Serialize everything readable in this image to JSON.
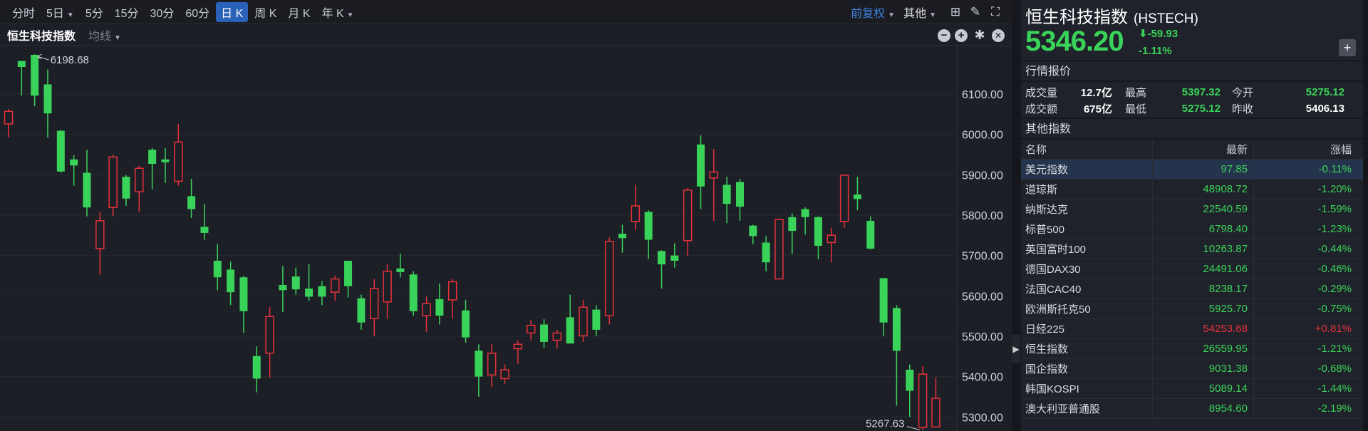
{
  "toolbar": {
    "periods": [
      "分时",
      "5日",
      "5分",
      "15分",
      "30分",
      "60分",
      "日 K",
      "周 K",
      "月 K",
      "年 K"
    ],
    "active": "日 K",
    "adjust": "前复权",
    "other": "其他"
  },
  "subbar": {
    "title": "恒生科技指数",
    "ma": "均线"
  },
  "header": {
    "name": "恒生科技指数",
    "code": "(HSTECH)",
    "price": "5346.20",
    "change": "-59.93",
    "change_pct": "-1.11%"
  },
  "quote": {
    "section": "行情报价",
    "volume_label": "成交量",
    "volume": "12.7亿",
    "high_label": "最高",
    "high": "5397.32",
    "open_label": "今开",
    "open": "5275.12",
    "amount_label": "成交额",
    "amount": "675亿",
    "low_label": "最低",
    "low": "5275.12",
    "prev_label": "昨收",
    "prev": "5406.13"
  },
  "others": {
    "section": "其他指数",
    "headers": [
      "名称",
      "最新",
      "涨幅"
    ],
    "rows": [
      {
        "name": "美元指数",
        "last": "97.85",
        "chg": "-0.11%",
        "dir": "down"
      },
      {
        "name": "道琼斯",
        "last": "48908.72",
        "chg": "-1.20%",
        "dir": "down"
      },
      {
        "name": "纳斯达克",
        "last": "22540.59",
        "chg": "-1.59%",
        "dir": "down"
      },
      {
        "name": "标普500",
        "last": "6798.40",
        "chg": "-1.23%",
        "dir": "down"
      },
      {
        "name": "英国富时100",
        "last": "10263.87",
        "chg": "-0.44%",
        "dir": "down"
      },
      {
        "name": "德国DAX30",
        "last": "24491.06",
        "chg": "-0.46%",
        "dir": "down"
      },
      {
        "name": "法国CAC40",
        "last": "8238.17",
        "chg": "-0.29%",
        "dir": "down"
      },
      {
        "name": "欧洲斯托克50",
        "last": "5925.70",
        "chg": "-0.75%",
        "dir": "down"
      },
      {
        "name": "日经225",
        "last": "54253.68",
        "chg": "+0.81%",
        "dir": "up"
      },
      {
        "name": "恒生指数",
        "last": "26559.95",
        "chg": "-1.21%",
        "dir": "down"
      },
      {
        "name": "国企指数",
        "last": "9031.38",
        "chg": "-0.68%",
        "dir": "down"
      },
      {
        "name": "韩国KOSPI",
        "last": "5089.14",
        "chg": "-1.44%",
        "dir": "down"
      },
      {
        "name": "澳大利亚普通股",
        "last": "8954.60",
        "chg": "-2.19%",
        "dir": "down"
      }
    ]
  },
  "colors": {
    "up": "#e8313b",
    "down": "#3ad35a",
    "accent": "#2962b8"
  },
  "chart_data": {
    "type": "candlestick",
    "title": "恒生科技指数",
    "ylim": [
      5260,
      6210
    ],
    "y_ticks": [
      "6100.00",
      "6000.00",
      "5900.00",
      "5800.00",
      "5700.00",
      "5600.00",
      "5500.00",
      "5400.00",
      "5300.00"
    ],
    "max_label": "6198.68",
    "min_label": "5267.63",
    "ohlc": [
      [
        6026,
        6063,
        5992,
        6057
      ],
      [
        6182,
        6182,
        6096,
        6167
      ],
      [
        6197,
        6198.68,
        6070,
        6096
      ],
      [
        6124,
        6161,
        5992,
        6052
      ],
      [
        6009,
        6011,
        5905,
        5908
      ],
      [
        5938,
        5949,
        5873,
        5923
      ],
      [
        5905,
        5962,
        5797,
        5819
      ],
      [
        5717,
        5808,
        5653,
        5786
      ],
      [
        5819,
        5949,
        5797,
        5944
      ],
      [
        5895,
        5899,
        5823,
        5841
      ],
      [
        5858,
        5923,
        5808,
        5916
      ],
      [
        5962,
        5966,
        5864,
        5927
      ],
      [
        5938,
        5966,
        5880,
        5931
      ],
      [
        5884,
        6026,
        5873,
        5981
      ],
      [
        5847,
        5890,
        5793,
        5815
      ],
      [
        5771,
        5828,
        5739,
        5756
      ],
      [
        5687,
        5728,
        5614,
        5646
      ],
      [
        5665,
        5685,
        5577,
        5609
      ],
      [
        5646,
        5650,
        5508,
        5562
      ],
      [
        5451,
        5475,
        5361,
        5395
      ],
      [
        5458,
        5572,
        5397,
        5549
      ],
      [
        5627,
        5674,
        5560,
        5614
      ],
      [
        5648,
        5670,
        5603,
        5616
      ],
      [
        5618,
        5678,
        5588,
        5598
      ],
      [
        5624,
        5637,
        5577,
        5598
      ],
      [
        5609,
        5650,
        5588,
        5642
      ],
      [
        5687,
        5687,
        5596,
        5624
      ],
      [
        5594,
        5603,
        5516,
        5534
      ],
      [
        5544,
        5642,
        5501,
        5618
      ],
      [
        5585,
        5678,
        5544,
        5661
      ],
      [
        5668,
        5704,
        5646,
        5659
      ],
      [
        5653,
        5661,
        5551,
        5562
      ],
      [
        5551,
        5598,
        5510,
        5581
      ],
      [
        5592,
        5631,
        5529,
        5551
      ],
      [
        5590,
        5642,
        5544,
        5635
      ],
      [
        5564,
        5590,
        5484,
        5497
      ],
      [
        5464,
        5480,
        5350,
        5400
      ],
      [
        5404,
        5480,
        5374,
        5458
      ],
      [
        5395,
        5430,
        5382,
        5417
      ],
      [
        5469,
        5490,
        5432,
        5480
      ],
      [
        5508,
        5540,
        5490,
        5527
      ],
      [
        5529,
        5542,
        5471,
        5486
      ],
      [
        5490,
        5516,
        5469,
        5508
      ],
      [
        5547,
        5603,
        5482,
        5482
      ],
      [
        5501,
        5590,
        5486,
        5572
      ],
      [
        5566,
        5577,
        5501,
        5516
      ],
      [
        5551,
        5745,
        5529,
        5735
      ],
      [
        5754,
        5776,
        5707,
        5743
      ],
      [
        5784,
        5875,
        5763,
        5823
      ],
      [
        5808,
        5812,
        5691,
        5739
      ],
      [
        5711,
        5713,
        5618,
        5678
      ],
      [
        5700,
        5730,
        5670,
        5687
      ],
      [
        5737,
        5867,
        5700,
        5862
      ],
      [
        5975,
        5998,
        5815,
        5871
      ],
      [
        5892,
        5964,
        5786,
        5907
      ],
      [
        5875,
        5895,
        5780,
        5828
      ],
      [
        5882,
        5890,
        5786,
        5821
      ],
      [
        5774,
        5776,
        5728,
        5748
      ],
      [
        5732,
        5748,
        5661,
        5683
      ],
      [
        5642,
        5791,
        5642,
        5789
      ],
      [
        5795,
        5804,
        5704,
        5761
      ],
      [
        5815,
        5819,
        5752,
        5795
      ],
      [
        5795,
        5797,
        5691,
        5724
      ],
      [
        5732,
        5769,
        5683,
        5750
      ],
      [
        5784,
        5899,
        5769,
        5899
      ],
      [
        5851,
        5895,
        5812,
        5840
      ],
      [
        5786,
        5797,
        5715,
        5717
      ],
      [
        5644,
        5644,
        5501,
        5534
      ],
      [
        5570,
        5577,
        5328,
        5464
      ],
      [
        5417,
        5430,
        5300,
        5365
      ],
      [
        5274,
        5426,
        5267.63,
        5406.13
      ],
      [
        5275.12,
        5397.32,
        5275.12,
        5346.2
      ]
    ]
  }
}
